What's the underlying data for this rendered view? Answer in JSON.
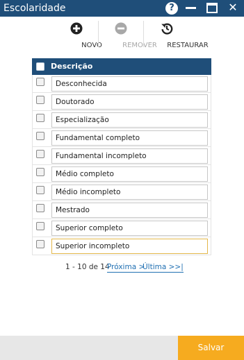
{
  "window": {
    "title": "Escolaridade",
    "help_glyph": "?",
    "close_glyph": "✕"
  },
  "toolbar": {
    "novo_label": "NOVO",
    "remover_label": "REMOVER",
    "restaurar_label": "RESTAURAR",
    "icons": {
      "novo": "plus-circle-icon",
      "remover": "minus-circle-icon",
      "restaurar": "history-icon"
    }
  },
  "grid": {
    "header": "Descrição",
    "rows": [
      "Desconhecida",
      "Doutorado",
      "Especialização",
      "Fundamental completo",
      "Fundamental incompleto",
      "Médio completo",
      "Médio incompleto",
      "Mestrado",
      "Superior completo",
      "Superior incompleto"
    ]
  },
  "pager": {
    "info": "1 - 10 de 14",
    "next_label": "Próxima >",
    "last_label": "Última >>|"
  },
  "footer": {
    "save_label": "Salvar"
  },
  "colors": {
    "header": "#1f4e79",
    "save": "#f6ab1f",
    "link": "#1f6fb2",
    "focus": "#e3b74a"
  }
}
